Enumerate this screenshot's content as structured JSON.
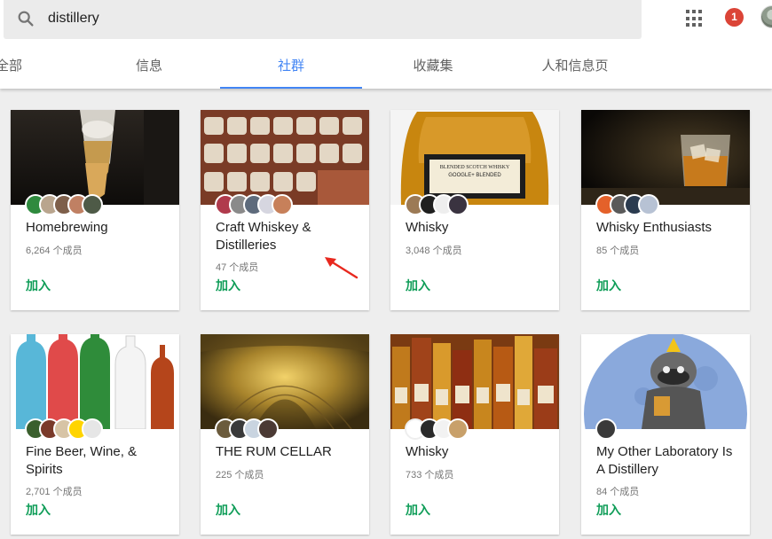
{
  "search": {
    "query": "distillery"
  },
  "notifications": {
    "count": "1"
  },
  "tabs": [
    {
      "label": "全部"
    },
    {
      "label": "信息"
    },
    {
      "label": "社群"
    },
    {
      "label": "收藏集"
    },
    {
      "label": "人和信息页"
    }
  ],
  "cards": [
    {
      "name": "Homebrewing",
      "members": "6,264 个成员",
      "join": "加入"
    },
    {
      "name": "Craft Whiskey & Distilleries",
      "members": "47 个成员",
      "join": "加入"
    },
    {
      "name": "Whisky",
      "members": "3,048 个成员",
      "join": "加入"
    },
    {
      "name": "Whisky Enthusiasts",
      "members": "85 个成员",
      "join": "加入"
    },
    {
      "name": "Fine Beer, Wine, & Spirits",
      "members": "2,701 个成员",
      "join": "加入"
    },
    {
      "name": "THE RUM CELLAR",
      "members": "225 个成员",
      "join": "加入"
    },
    {
      "name": "Whisky",
      "members": "733 个成员",
      "join": "加入"
    },
    {
      "name": "My Other Laboratory Is A Distillery",
      "members": "84 个成员",
      "join": "加入"
    }
  ],
  "cover_texts": {
    "bottle_label": "BLENDED SCOTCH WHISKY",
    "bottle_label2": "GOOGLE+ BLENDED"
  },
  "colors": {
    "accent": "#4285f4",
    "join": "#0f9d58",
    "badge": "#db4437"
  }
}
